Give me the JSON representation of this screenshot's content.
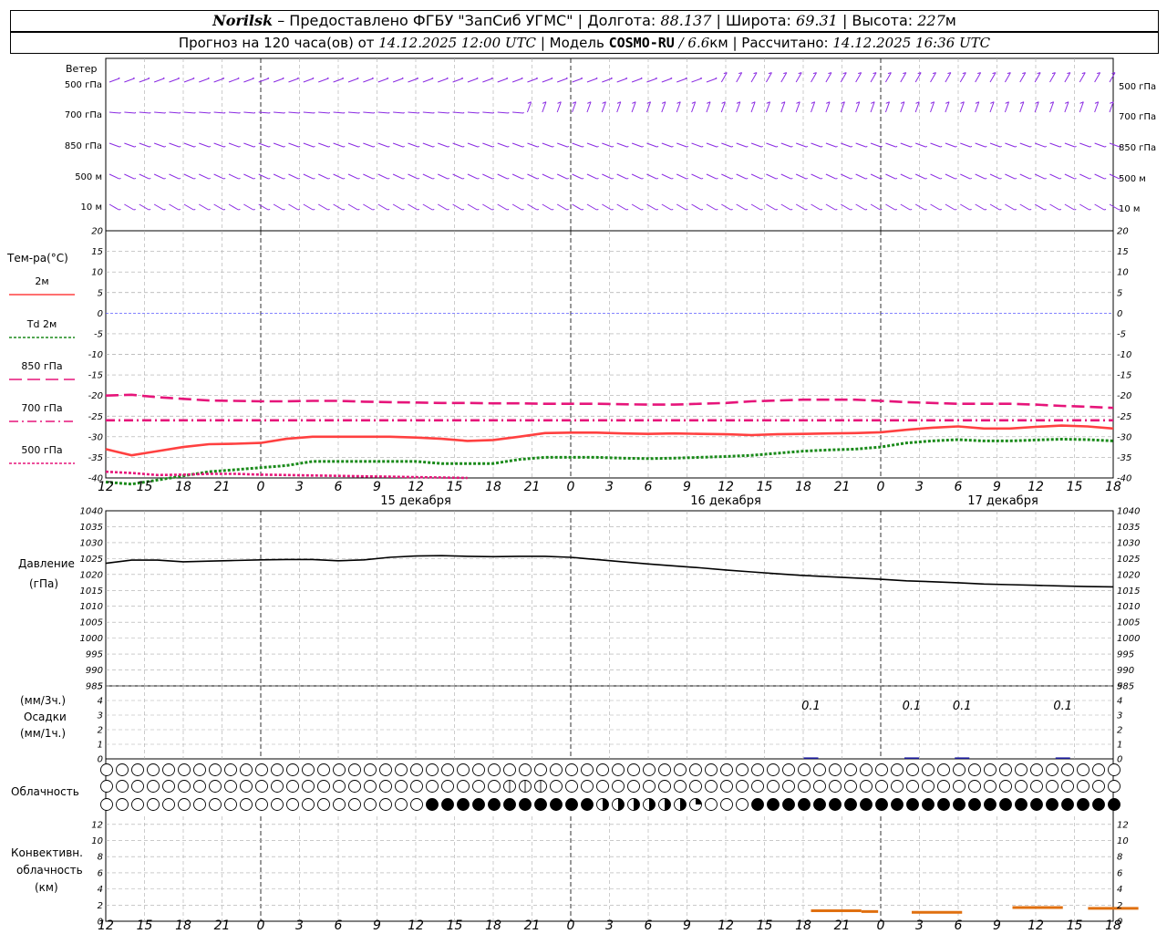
{
  "header": {
    "city": "Norilsk",
    "provider": "– Предоставлено ФГБУ \"ЗапСиб УГМС\" |",
    "lon_label": "Долгота:",
    "lon": "88.137",
    "lat_label": "| Широта:",
    "lat": "69.31",
    "alt_label": "| Высота:",
    "alt": "227",
    "alt_unit": "м",
    "forecast_prefix": "Прогноз на 120 часа(ов) от",
    "forecast_time": "14.12.2025 12:00 UTC",
    "model_label": "| Модель",
    "model": "COSMO-RU",
    "model_res": "/ 6.6",
    "model_res_unit": "км",
    "computed_label": "| Рассчитано:",
    "computed_time": "14.12.2025 16:36 UTC"
  },
  "wind_panel": {
    "title": "Ветер",
    "levels": [
      "500 гПа",
      "700 гПа",
      "850 гПа",
      "500 м",
      "10  м"
    ],
    "color": "#8a2be2"
  },
  "temp_panel": {
    "title": "Тем-ра(°C)",
    "legend": [
      {
        "label": "2м",
        "color": "#ff4040",
        "dash": "solid"
      },
      {
        "label": "Td  2м",
        "color": "#1a8a1a",
        "dash": "dot"
      },
      {
        "label": "850 гПа",
        "color": "#e6157a",
        "dash": "dash"
      },
      {
        "label": "700 гПа",
        "color": "#e6157a",
        "dash": "dashdot"
      },
      {
        "label": "500 гПа",
        "color": "#e6157a",
        "dash": "dot"
      }
    ]
  },
  "pressure_panel": {
    "title": "Давление",
    "unit": "(гПа)"
  },
  "precip_panel": {
    "unit3h": "(мм/3ч.)",
    "title": "Осадки",
    "unit1h": "(мм/1ч.)",
    "labels": [
      {
        "hour": 84,
        "text": "0.1"
      },
      {
        "hour": 96,
        "text": "0.1"
      },
      {
        "hour": 102,
        "text": "0.1"
      },
      {
        "hour": 114,
        "text": "0.1"
      }
    ]
  },
  "cloud_panel": {
    "title": "Облачность",
    "rows": [
      "000000000000000000000000000000000000000000000000000000000000000000000000000000000000000000000000000000000000000000000000",
      "000000000000000000000000000000000000000000000011111100000000000000000000000000000000000000000000000000000000000000000000",
      "000000000000000000000000000000000000000000000000000444444444444444444444444444444333333333333333222000000444444444444444444444444444444444444444444444444444444444444444"
    ]
  },
  "conv_panel": {
    "title1": "Конвективн.",
    "title2": "облачность",
    "unit": "(км)"
  },
  "time_axis": {
    "hour_labels": [
      "12",
      "15",
      "18",
      "21",
      "0",
      "3",
      "6",
      "9",
      "12",
      "15",
      "18",
      "21",
      "0",
      "3",
      "6",
      "9",
      "12",
      "15",
      "18",
      "21",
      "0",
      "3",
      "6",
      "9",
      "12",
      "15",
      "18"
    ],
    "date_labels": [
      {
        "hour": 24,
        "text": "15 декабря"
      },
      {
        "hour": 48,
        "text": "16 декабря"
      },
      {
        "hour": 72,
        "text": "17 декабря"
      }
    ]
  },
  "chart_data": [
    {
      "type": "line",
      "title": "Тем-ра(°C)",
      "ylim": [
        -40,
        20
      ],
      "yticks": [
        -40,
        -35,
        -30,
        -25,
        -20,
        -15,
        -10,
        -5,
        0,
        5,
        10,
        15,
        20
      ],
      "xlim_hours": [
        0,
        78
      ],
      "grid": true,
      "series": [
        {
          "name": "2м",
          "color": "#ff4040",
          "x": [
            0,
            2,
            4,
            6,
            8,
            10,
            12,
            14,
            16,
            18,
            20,
            22,
            24,
            26,
            28,
            30,
            32,
            34,
            36,
            38,
            40,
            42,
            44,
            46,
            48,
            50,
            52,
            54,
            56,
            58,
            60,
            62,
            64,
            66,
            68,
            70,
            72,
            74,
            76,
            78
          ],
          "y": [
            -33,
            -34.5,
            -33.5,
            -32.5,
            -31.8,
            -31.7,
            -31.5,
            -30.5,
            -30,
            -30,
            -30,
            -30,
            -30.2,
            -30.5,
            -31,
            -30.8,
            -30,
            -29.1,
            -29,
            -29,
            -29.2,
            -29.3,
            -29.2,
            -29.3,
            -29.4,
            -29.6,
            -29.4,
            -29.3,
            -29.2,
            -29.1,
            -28.9,
            -28.3,
            -27.8,
            -27.5,
            -28,
            -28,
            -27.6,
            -27.3,
            -27.5,
            -28
          ]
        },
        {
          "name": "Td  2м",
          "color": "#1a8a1a",
          "x": [
            0,
            2,
            4,
            6,
            8,
            10,
            12,
            14,
            16,
            18,
            20,
            22,
            24,
            26,
            28,
            30,
            32,
            34,
            36,
            38,
            40,
            42,
            44,
            46,
            48,
            50,
            52,
            54,
            56,
            58,
            60,
            62,
            64,
            66,
            68,
            70,
            72,
            74,
            76,
            78
          ],
          "y": [
            -41,
            -41.5,
            -40.5,
            -39.5,
            -38.5,
            -38,
            -37.5,
            -37,
            -36,
            -36,
            -36,
            -36,
            -36,
            -36.5,
            -36.5,
            -36.5,
            -35.5,
            -35,
            -35,
            -35,
            -35.2,
            -35.3,
            -35.2,
            -35,
            -34.8,
            -34.5,
            -34,
            -33.5,
            -33.2,
            -33,
            -32.5,
            -31.5,
            -31,
            -30.7,
            -31,
            -31,
            -30.8,
            -30.6,
            -30.7,
            -31
          ]
        },
        {
          "name": "850 гПа",
          "color": "#e6157a",
          "x": [
            0,
            2,
            4,
            6,
            8,
            10,
            12,
            14,
            16,
            18,
            20,
            22,
            24,
            26,
            28,
            30,
            32,
            34,
            36,
            38,
            40,
            42,
            44,
            46,
            48,
            50,
            52,
            54,
            56,
            58,
            60,
            62,
            64,
            66,
            68,
            70,
            72,
            74,
            76,
            78
          ],
          "y": [
            -20,
            -19.8,
            -20.4,
            -20.8,
            -21.2,
            -21.3,
            -21.4,
            -21.4,
            -21.3,
            -21.3,
            -21.5,
            -21.6,
            -21.7,
            -21.8,
            -21.8,
            -21.9,
            -21.9,
            -22,
            -22,
            -22,
            -22.1,
            -22.2,
            -22.2,
            -22,
            -21.8,
            -21.4,
            -21.2,
            -21,
            -21,
            -21,
            -21.3,
            -21.6,
            -21.8,
            -22,
            -22,
            -22,
            -22.2,
            -22.5,
            -22.7,
            -23
          ]
        },
        {
          "name": "700 гПа",
          "color": "#e6157a",
          "x": [
            0,
            6,
            12,
            18,
            24,
            30,
            36,
            42,
            48,
            54,
            60,
            66,
            72,
            78
          ],
          "y": [
            -26,
            -26,
            -26,
            -26,
            -26,
            -26,
            -26,
            -26,
            -26,
            -26,
            -26,
            -26,
            -26,
            -26
          ]
        },
        {
          "name": "500 гПа",
          "color": "#e6157a",
          "x": [
            0,
            2,
            4,
            6,
            8,
            10,
            12,
            14,
            16,
            18,
            20,
            22,
            24,
            26,
            28
          ],
          "y": [
            -38.5,
            -38.8,
            -39.3,
            -39.2,
            -39,
            -39,
            -39.2,
            -39.3,
            -39.4,
            -39.5,
            -39.6,
            -39.7,
            -39.8,
            -39.9,
            -40
          ]
        }
      ]
    },
    {
      "type": "line",
      "title": "Давление (гПа)",
      "ylim": [
        985,
        1040
      ],
      "yticks": [
        985,
        990,
        995,
        1000,
        1005,
        1010,
        1015,
        1020,
        1025,
        1030,
        1035,
        1040
      ],
      "xlim_hours": [
        0,
        78
      ],
      "grid": true,
      "series": [
        {
          "name": "",
          "color": "#000000",
          "x": [
            0,
            2,
            4,
            6,
            8,
            10,
            12,
            14,
            16,
            18,
            20,
            22,
            24,
            26,
            28,
            30,
            32,
            34,
            36,
            38,
            40,
            42,
            44,
            46,
            48,
            50,
            52,
            54,
            56,
            58,
            60,
            62,
            64,
            66,
            68,
            70,
            72,
            74,
            76,
            78
          ],
          "y": [
            1023.5,
            1024.5,
            1024.5,
            1024,
            1024.2,
            1024.4,
            1024.6,
            1024.7,
            1024.7,
            1024.3,
            1024.6,
            1025.4,
            1025.8,
            1025.9,
            1025.7,
            1025.6,
            1025.7,
            1025.7,
            1025.4,
            1024.7,
            1024,
            1023.3,
            1022.7,
            1022.1,
            1021.4,
            1020.8,
            1020.2,
            1019.7,
            1019.3,
            1018.9,
            1018.5,
            1018,
            1017.7,
            1017.4,
            1017,
            1016.8,
            1016.6,
            1016.4,
            1016.2,
            1016.1
          ]
        }
      ]
    },
    {
      "type": "bar",
      "title": "Осадки",
      "ylim": [
        0,
        5
      ],
      "yticks": [
        0,
        1,
        2,
        3,
        4,
        5
      ],
      "grid": true,
      "x": [
        84,
        96,
        102,
        114
      ],
      "values": [
        0.1,
        0.1,
        0.1,
        0.1
      ]
    },
    {
      "type": "bar",
      "title": "Конвективн. облачность (км)",
      "ylim": [
        0,
        13
      ],
      "yticks": [
        0,
        2,
        4,
        6,
        8,
        10,
        12
      ],
      "grid": true,
      "segments": [
        {
          "x0": 84,
          "x1": 90,
          "y": 1.3
        },
        {
          "x0": 90,
          "x1": 92,
          "y": 1.2
        },
        {
          "x0": 96,
          "x1": 102,
          "y": 1.1
        },
        {
          "x0": 108,
          "x1": 114,
          "y": 1.7
        },
        {
          "x0": 117,
          "x1": 123,
          "y": 1.6
        }
      ]
    }
  ]
}
